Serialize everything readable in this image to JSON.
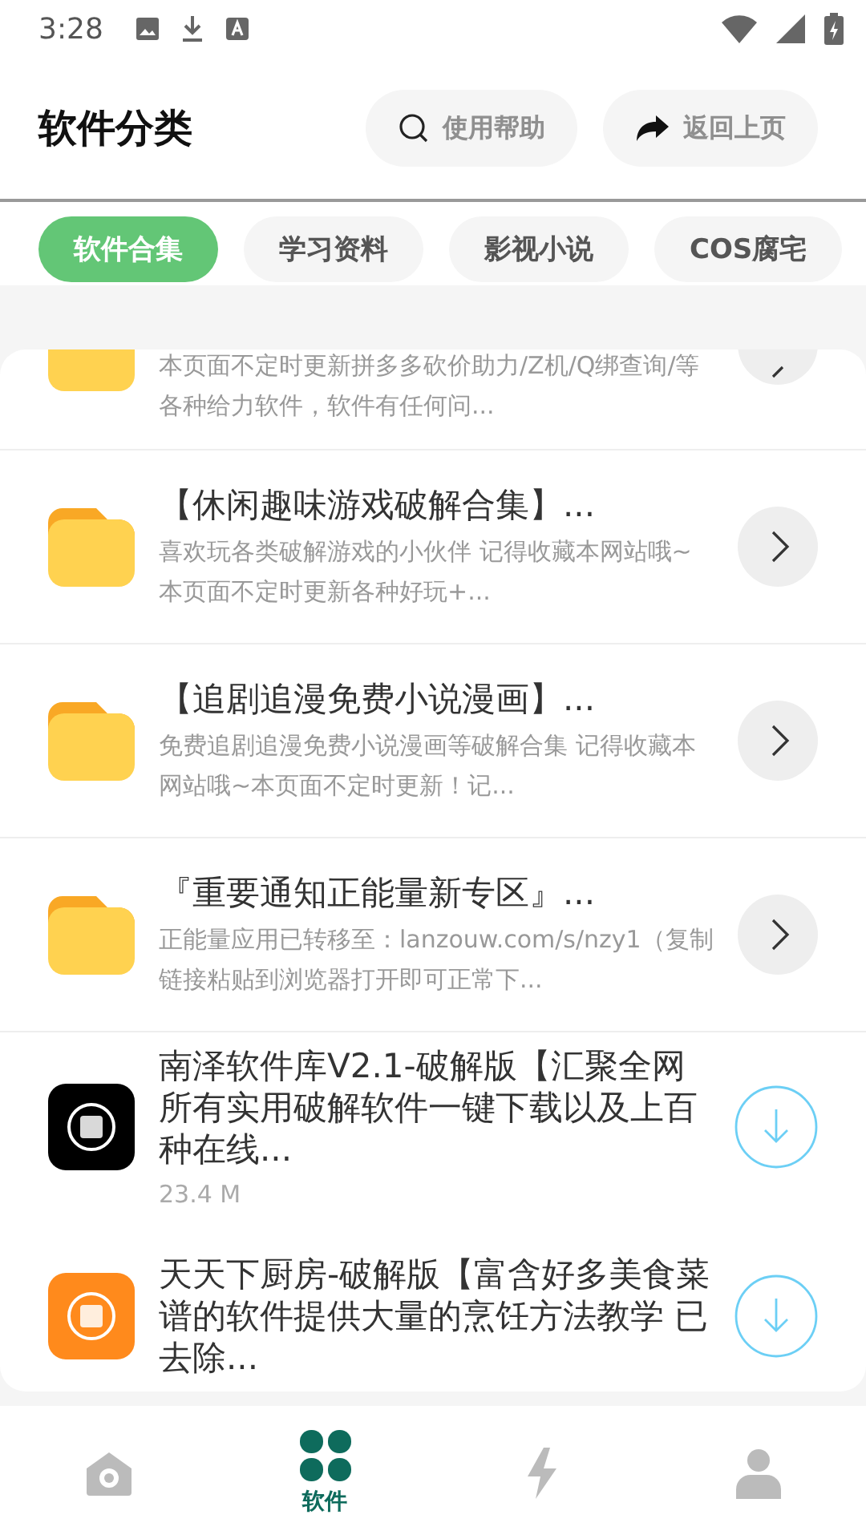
{
  "status_bar": {
    "time": "3:28"
  },
  "header": {
    "title": "软件分类",
    "buttons": [
      {
        "kind": "search",
        "label": "使用帮助"
      },
      {
        "kind": "share",
        "label": "返回上页"
      }
    ]
  },
  "tabs": [
    {
      "label": "软件合集",
      "selected": true
    },
    {
      "label": "学习资料",
      "selected": false
    },
    {
      "label": "影视小说",
      "selected": false
    },
    {
      "label": "COS腐宅",
      "selected": false
    }
  ],
  "items": [
    {
      "kind": "partial",
      "description": "本页面不定时更新拼多多砍价助力/Z机/Q绑查询/等各种给力软件，软件有任何问..."
    },
    {
      "kind": "folder",
      "title": "【休闲趣味游戏破解合集】...",
      "description": "喜欢玩各类破解游戏的小伙伴 记得收藏本网站哦~本页面不定时更新各种好玩+..."
    },
    {
      "kind": "folder",
      "title": "【追剧追漫免费小说漫画】...",
      "description": "免费追剧追漫免费小说漫画等破解合集 记得收藏本网站哦~本页面不定时更新！记..."
    },
    {
      "kind": "folder",
      "title": "『重要通知正能量新专区』...",
      "description": "正能量应用已转移至：lanzouw.com/s/nzy1（复制链接粘贴到浏览器打开即可正常下..."
    },
    {
      "kind": "app",
      "title": "南泽软件库V2.1-破解版【汇聚全网所有实用破解软件一键下载以及上百种在线...",
      "size": "23.4 M",
      "color": "#000000"
    },
    {
      "kind": "app",
      "title": "天天下厨房-破解版【富含好多美食菜谱的软件提供大量的烹饪方法教学 已去除...",
      "color": "#ff8a1c"
    }
  ],
  "bottom_nav": [
    {
      "kind": "home",
      "selected": false
    },
    {
      "kind": "apps",
      "label": "软件",
      "selected": true
    },
    {
      "kind": "bolt",
      "selected": false
    },
    {
      "kind": "person",
      "selected": false
    }
  ]
}
